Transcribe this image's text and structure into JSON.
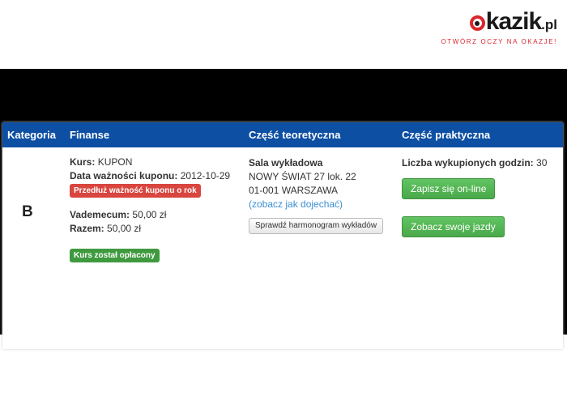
{
  "logo": {
    "word": "kazik",
    "suffix": ".pl",
    "tagline": "OTWÓRZ OCZY NA OKAZJE!"
  },
  "table": {
    "headers": {
      "category": "Kategoria",
      "finance": "Finanse",
      "theory": "Część teoretyczna",
      "practice": "Część praktyczna"
    },
    "row": {
      "category": "B",
      "finance": {
        "course_label": "Kurs:",
        "course_value": "KUPON",
        "validity_label": "Data ważności kuponu:",
        "validity_value": "2012-10-29",
        "extend_button": "Przedłuż ważność kuponu o rok",
        "vademecum_label": "Vademecum:",
        "vademecum_value": "50,00 zł",
        "total_label": "Razem:",
        "total_value": "50,00 zł",
        "paid_badge": "Kurs został opłacony"
      },
      "theory": {
        "hall_title": "Sala wykładowa",
        "address_line1": "NOWY ŚWIAT 27 lok. 22",
        "address_line2": "01-001 WARSZAWA",
        "directions_link": "(zobacz jak dojechać)",
        "schedule_button": "Sprawdź harmonogram wykładów"
      },
      "practice": {
        "hours_label": "Liczba wykupionych godzin:",
        "hours_value": "30",
        "signup_button": "Zapisz się on-line",
        "rides_button": "Zobacz swoje jazdy"
      }
    }
  },
  "colors": {
    "header_bg": "#0d4fa3",
    "brand_red": "#d9262c",
    "button_green": "#4aa84a",
    "link_blue": "#3a8fd3"
  }
}
